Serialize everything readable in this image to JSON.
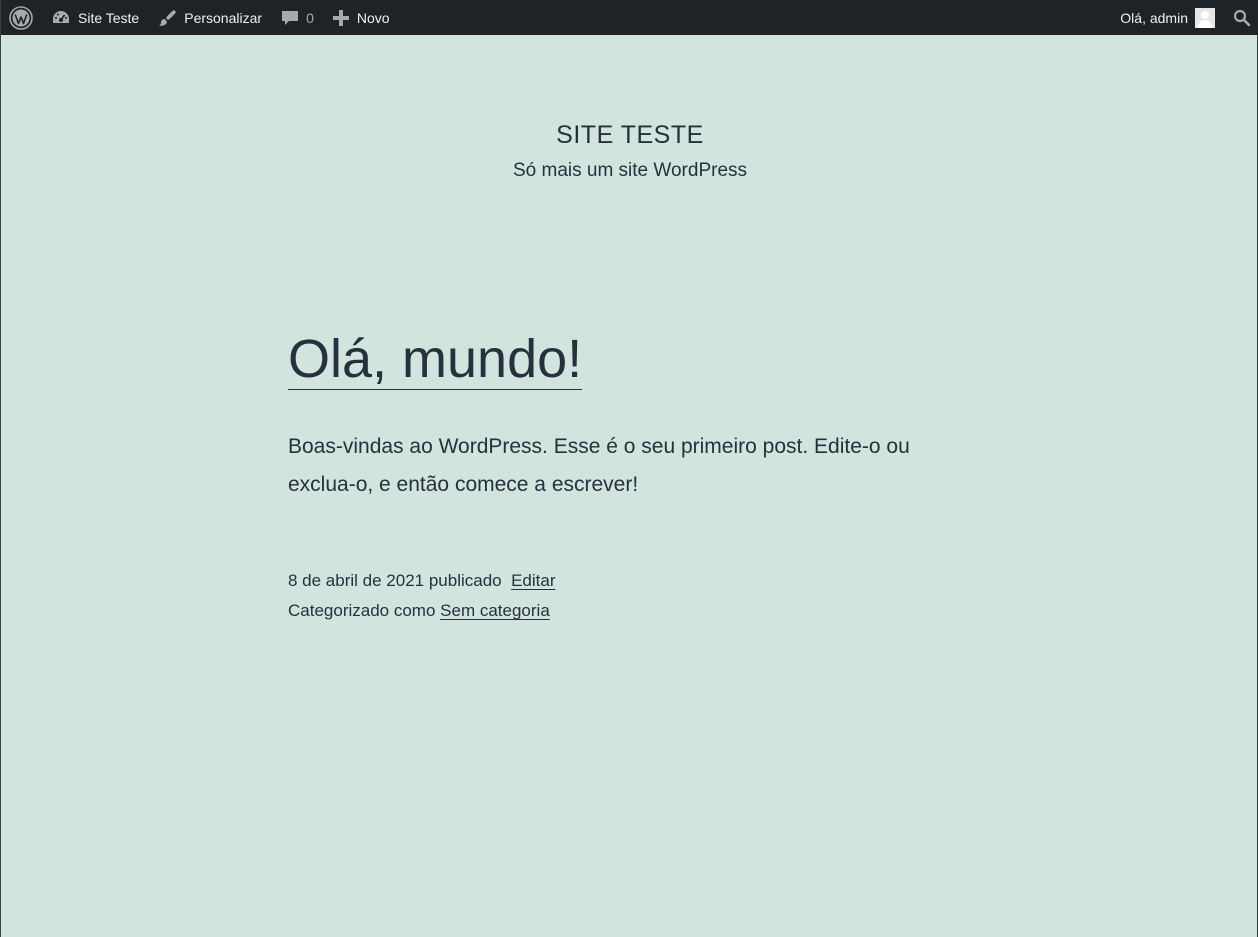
{
  "admin_bar": {
    "site_name": "Site Teste",
    "customize": "Personalizar",
    "comments_count": "0",
    "new": "Novo",
    "greeting": "Olá, admin"
  },
  "site": {
    "title": "SITE TESTE",
    "description": "Só mais um site WordPress"
  },
  "post": {
    "title": "Olá, mundo!",
    "content": "Boas-vindas ao WordPress. Esse é o seu primeiro post. Edite-o ou exclua-o, e então comece a escrever!",
    "date_text": "8 de abril de 2021 publicado",
    "edit_label": "Editar",
    "categorized_label": "Categorizado como",
    "category": "Sem categoria"
  },
  "colors": {
    "admin_bar_bg": "#1d2327",
    "page_bg": "#d1e4dd",
    "text": "#28303d"
  }
}
